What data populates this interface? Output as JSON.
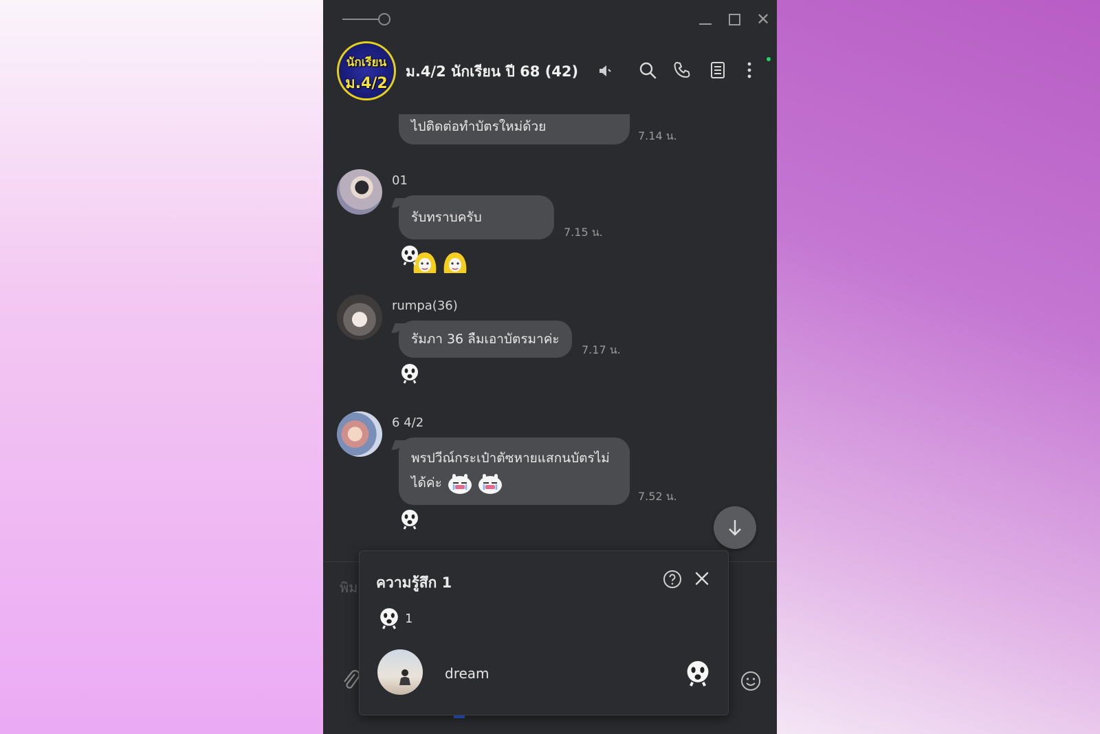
{
  "window": {
    "title": "ม.4/2 นักเรียน ปี 68 (42)",
    "avatar_line1": "นักเรียน",
    "avatar_line2": "ม.4/2"
  },
  "header_icons": [
    "speaker-mute-icon",
    "search-icon",
    "phone-icon",
    "notes-icon",
    "more-icon"
  ],
  "messages": [
    {
      "sender": "",
      "text": "ไปติดต่อทำบัตรใหม่ด้วย",
      "time": "7.14 น."
    },
    {
      "sender": "01",
      "text": "รับทราบครับ",
      "time": "7.15 น."
    },
    {
      "sender": "rumpa(36)",
      "text": "รัมภา 36 ลืมเอาบัตรมาค่ะ",
      "time": "7.17 น."
    },
    {
      "sender": "6 4/2",
      "text_line1": "พรปวีณ์กระเป๋าตัซหายแสกนบัตรไม่",
      "text_line2": "ได้ค่ะ",
      "time": "7.52 น."
    }
  ],
  "input": {
    "placeholder_partial": "พิม"
  },
  "reaction_popup": {
    "title": "ความรู้สึก 1",
    "count": "1",
    "users": [
      {
        "name": "dream"
      }
    ]
  },
  "colors": {
    "window_bg": "#2a2b2e",
    "bubble": "#4b4c4f",
    "avatar_ring": "#e6d11a",
    "online": "#1fd36a"
  }
}
